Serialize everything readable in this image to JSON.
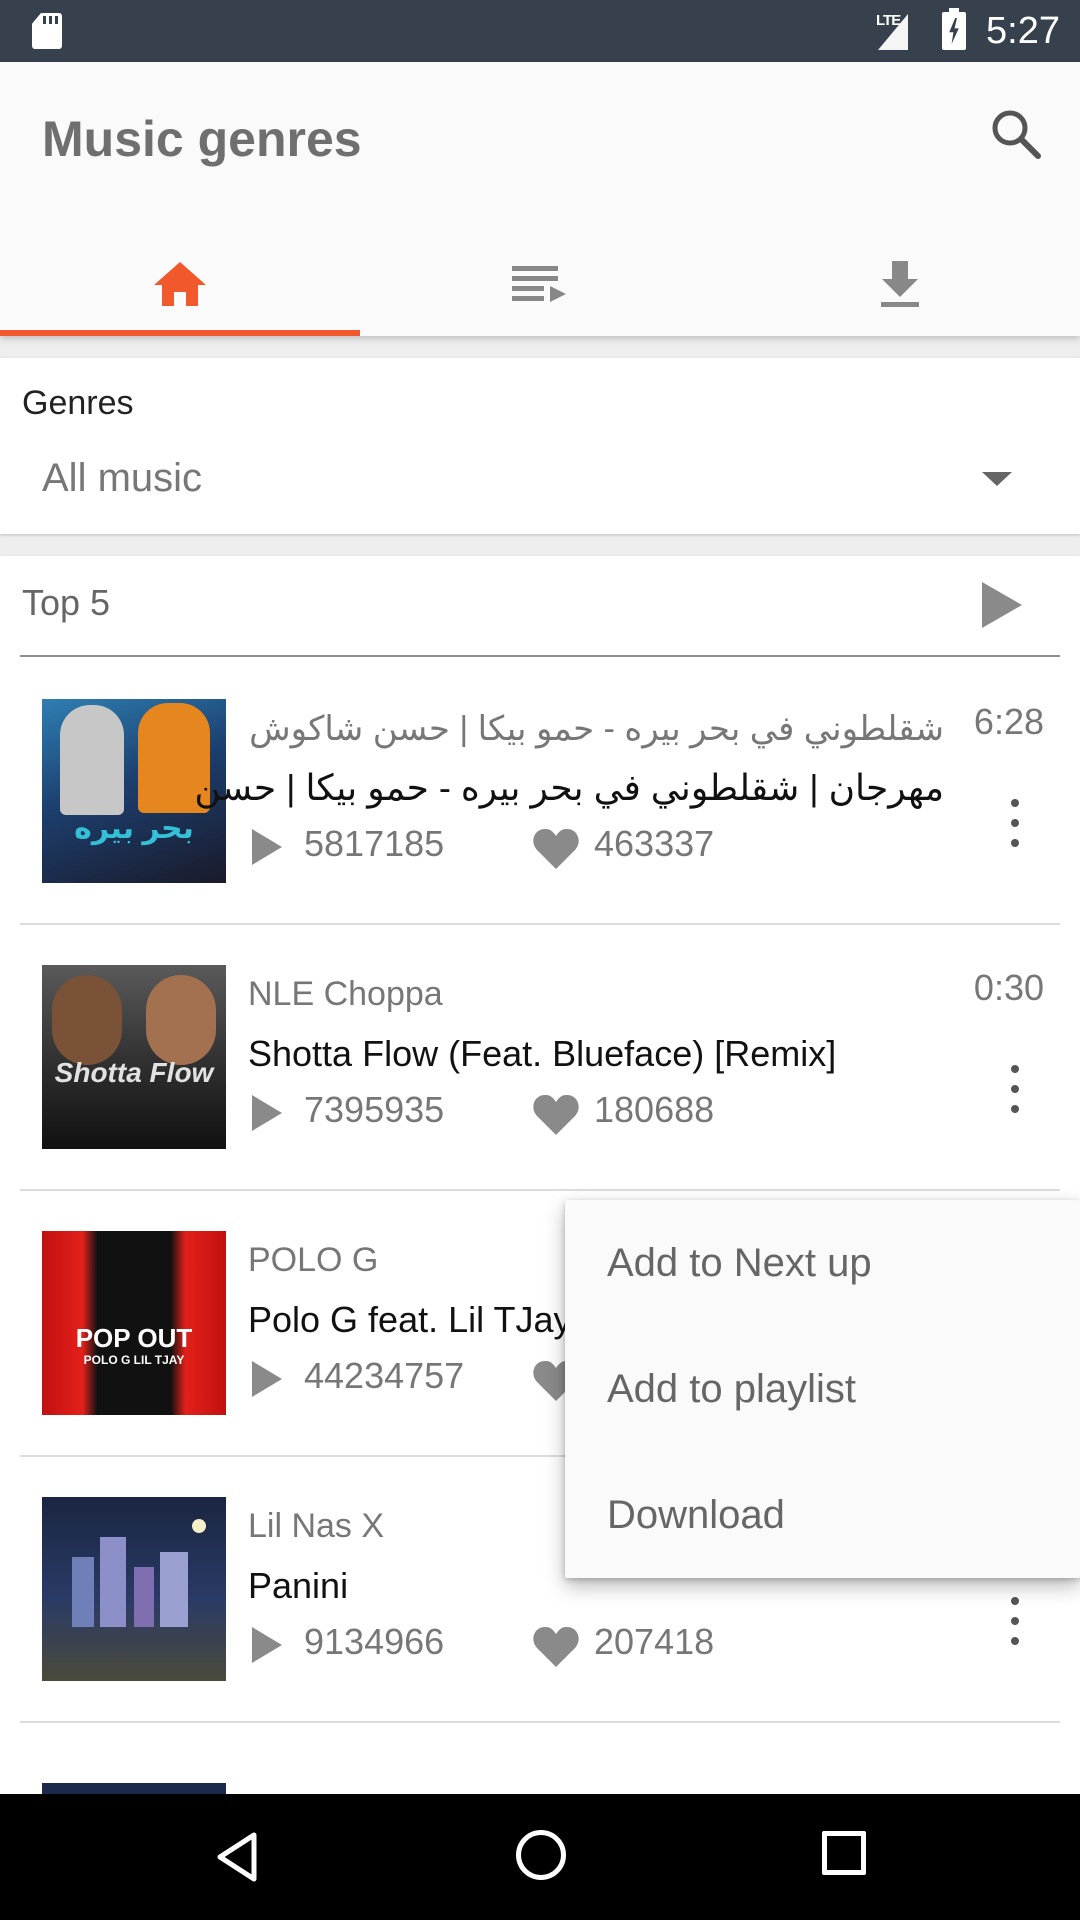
{
  "status_bar": {
    "time": "5:27",
    "network": "LTE"
  },
  "app_bar": {
    "title": "Music genres",
    "tabs": [
      {
        "icon": "home-icon",
        "selected": true
      },
      {
        "icon": "queue-music-icon",
        "selected": false
      },
      {
        "icon": "download-icon",
        "selected": false
      }
    ],
    "accent_color": "#f1582b"
  },
  "genre_filter": {
    "label": "Genres",
    "selected": "All music"
  },
  "top_list": {
    "title": "Top 5",
    "tracks": [
      {
        "artist": "شقلطوني في بحر بيره - حمو بيكا | حسن شاكوش",
        "title": "مهرجان | شقلطوني في بحر بيره - حمو بيكا | حسن",
        "duration": "6:28",
        "plays": "5817185",
        "likes": "463337",
        "cover_text": "بحر بيره"
      },
      {
        "artist": "NLE Choppa",
        "title": "Shotta Flow (Feat. Blueface) [Remix]",
        "duration": "0:30",
        "plays": "7395935",
        "likes": "180688",
        "cover_text": "Shotta Flow"
      },
      {
        "artist": "POLO G",
        "title": "Polo G feat. Lil TJay",
        "duration": "",
        "plays": "44234757",
        "likes": "",
        "cover_text": "POP OUT",
        "cover_subtext": "POLO G LIL TJAY"
      },
      {
        "artist": "Lil Nas X",
        "title": "Panini",
        "duration": "",
        "plays": "9134966",
        "likes": "207418",
        "cover_text": ""
      }
    ]
  },
  "popup_menu": {
    "items": [
      "Add to Next up",
      "Add to playlist",
      "Download"
    ]
  }
}
